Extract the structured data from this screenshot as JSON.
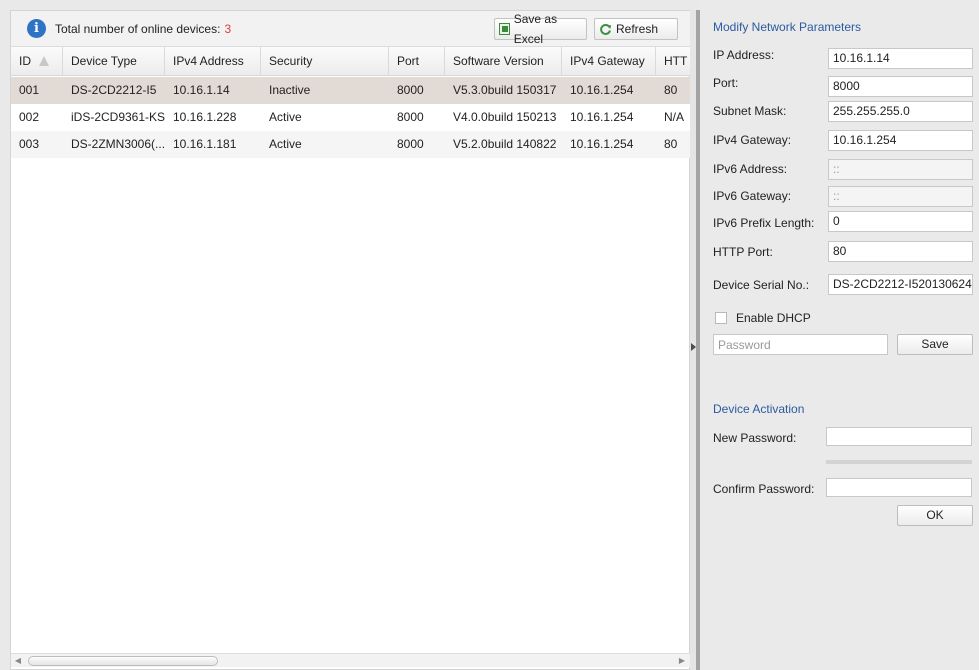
{
  "toolbar": {
    "total_label": "Total number of online devices:",
    "total_count": "3",
    "save_excel_label": "Save as Excel",
    "refresh_label": "Refresh",
    "info_icon": "info-icon",
    "excel_icon": "excel-icon",
    "refresh_icon": "refresh-icon"
  },
  "table": {
    "headers": [
      "ID",
      "Device Type",
      "IPv4 Address",
      "Security",
      "Port",
      "Software Version",
      "IPv4 Gateway",
      "HTT"
    ],
    "rows": [
      [
        "001",
        "DS-2CD2212-I5",
        "10.16.1.14",
        "Inactive",
        "8000",
        "V5.3.0build 150317",
        "10.16.1.254",
        "80"
      ],
      [
        "002",
        "iDS-2CD9361-KS",
        "10.16.1.228",
        "Active",
        "8000",
        "V4.0.0build 150213",
        "10.16.1.254",
        "N/A"
      ],
      [
        "003",
        "DS-2ZMN3006(...",
        "10.16.1.181",
        "Active",
        "8000",
        "V5.2.0build 140822",
        "10.16.1.254",
        "80"
      ]
    ],
    "selected_row_color": "#e2dad4"
  },
  "network": {
    "title": "Modify Network Parameters",
    "fields": [
      {
        "label": "IP Address:",
        "value": "10.16.1.14"
      },
      {
        "label": "Port:",
        "value": "8000"
      },
      {
        "label": "Subnet Mask:",
        "value": "255.255.255.0"
      },
      {
        "label": "IPv4 Gateway:",
        "value": "10.16.1.254"
      },
      {
        "label": "IPv6 Address:",
        "value": "::"
      },
      {
        "label": "IPv6 Gateway:",
        "value": "::"
      },
      {
        "label": "IPv6 Prefix Length:",
        "value": "0"
      },
      {
        "label": "HTTP Port:",
        "value": "80"
      },
      {
        "label": "Device Serial No.:",
        "value": "DS-2CD2212-I520130624"
      }
    ],
    "dhcp_label": "Enable DHCP",
    "password_placeholder": "Password",
    "save_label": "Save"
  },
  "activation": {
    "title": "Device Activation",
    "new_password_label": "New Password:",
    "confirm_password_label": "Confirm Password:",
    "ok_label": "OK"
  },
  "colors": {
    "accent_title": "#2c5aa0",
    "count_red": "#e23b3b",
    "info_blue": "#2f73c4"
  }
}
